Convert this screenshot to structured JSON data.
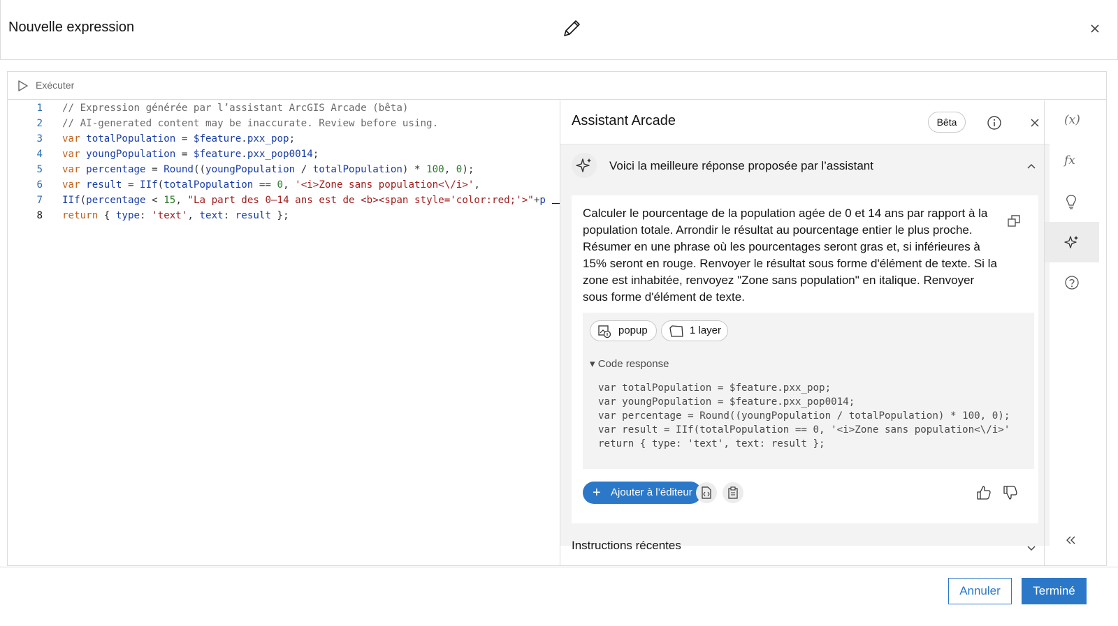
{
  "header": {
    "title": "Nouvelle expression"
  },
  "toolbar": {
    "run_label": "Exécuter"
  },
  "editor": {
    "lines": [
      {
        "num": "1",
        "text": "// Expression générée par l’assistant ArcGIS Arcade (bêta)"
      },
      {
        "num": "2",
        "text": "// AI-generated content may be inaccurate. Review before using."
      },
      {
        "num": "3",
        "text": "var totalPopulation = $feature.pxx_pop;"
      },
      {
        "num": "4",
        "text": "var youngPopulation = $feature.pxx_pop0014;"
      },
      {
        "num": "5",
        "text": "var percentage = Round((youngPopulation / totalPopulation) * 100, 0);"
      },
      {
        "num": "6",
        "text": "var result = IIf(totalPopulation == 0, '<i>Zone sans population<\\/i>',"
      },
      {
        "num": "7",
        "text": "IIf(percentage < 15, \"La part des 0–14 ans est de <b><span style='color:red;'>\"+p"
      },
      {
        "num": "8",
        "text": "return { type: 'text', text: result };"
      }
    ]
  },
  "assistant": {
    "title": "Assistant Arcade",
    "beta_label": "Bêta",
    "response_title": "Voici la meilleure réponse proposée par l’assistant",
    "prompt_text": "Calculer le pourcentage de la population agée de 0 et 14 ans par rapport à la population totale. Arrondir le résultat au pourcentage entier le plus proche. Résumer en une phrase où les pourcentages seront gras et, si inférieures à 15% seront en rouge. Renvoyer le résultat sous forme d'élément de texte. Si la zone est inhabitée, renvoyez \"Zone sans population\" en italique. Renvoyer sous forme d'élément de texte.",
    "chips": {
      "popup": "popup",
      "layer": "1 layer"
    },
    "code_response_label": "▾ Code response",
    "code_lines": [
      "var totalPopulation = $feature.pxx_pop;",
      "var youngPopulation = $feature.pxx_pop0014;",
      "var percentage = Round((youngPopulation / totalPopulation) * 100, 0);",
      "var result = IIf(totalPopulation == 0, '<i>Zone sans population<\\/i>'",
      "return { type: 'text', text: result };"
    ],
    "add_label": "Ajouter à l’éditeur",
    "recent_label": "Instructions récentes"
  },
  "rail": {
    "variables_label": "(x)",
    "functions_label": "fx"
  },
  "footer": {
    "cancel_label": "Annuler",
    "done_label": "Terminé"
  },
  "colors": {
    "accent": "#2b78c9",
    "keyword": "#c0621b",
    "identifier": "#1a3ea8",
    "string": "#a11e1e",
    "number": "#2f7a2f",
    "comment": "#6a6a6a"
  }
}
